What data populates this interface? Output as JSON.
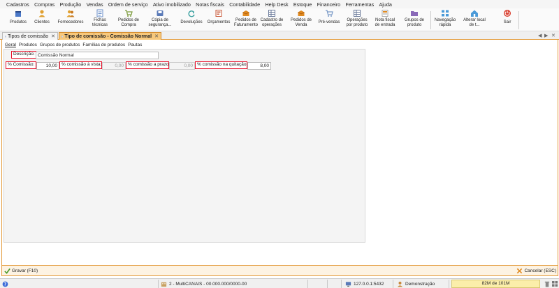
{
  "menu": [
    "Cadastros",
    "Compras",
    "Produção",
    "Vendas",
    "Ordem de serviço",
    "Ativo imobilizado",
    "Notas fiscais",
    "Contabilidade",
    "Help Desk",
    "Estoque",
    "Financeiro",
    "Ferramentas",
    "Ajuda"
  ],
  "toolbar": [
    {
      "l1": "Produtos",
      "l2": "",
      "icon": "box-icon",
      "color": "#4a78c8"
    },
    {
      "l1": "Clientes",
      "l2": "",
      "icon": "person-icon",
      "color": "#e0a030"
    },
    {
      "l1": "Fornecedores",
      "l2": "",
      "icon": "people-icon",
      "color": "#e0a030"
    },
    {
      "l1": "Fichas",
      "l2": "técnicas",
      "icon": "sheet-icon",
      "color": "#6a8fc8"
    },
    {
      "l1": "Pedidos de",
      "l2": "Compra",
      "icon": "cart-icon",
      "color": "#7a9a3a"
    },
    {
      "l1": "Cópia de",
      "l2": "segurança...",
      "icon": "backup-icon",
      "color": "#5a7ab8"
    },
    {
      "l1": "Devoluções",
      "l2": "",
      "icon": "return-icon",
      "color": "#3aa0a0"
    },
    {
      "l1": "Orçamentos",
      "l2": "",
      "icon": "quote-icon",
      "color": "#c85a3a"
    },
    {
      "l1": "Pedidos de",
      "l2": "Faturamento",
      "icon": "box-open-icon",
      "color": "#e08a20"
    },
    {
      "l1": "Cadastro de",
      "l2": "operações",
      "icon": "grid-icon",
      "color": "#6a7a9a"
    },
    {
      "l1": "Pedidos de",
      "l2": "Venda",
      "icon": "box-open-icon",
      "color": "#e08a20"
    },
    {
      "l1": "Pré-vendas",
      "l2": "",
      "icon": "cart-icon",
      "color": "#7a9ac8"
    },
    {
      "l1": "Operações",
      "l2": "por produto",
      "icon": "grid-icon",
      "color": "#6a7a9a"
    },
    {
      "l1": "Nota fiscal",
      "l2": "de entrada",
      "icon": "invoice-icon",
      "color": "#e08a20"
    },
    {
      "l1": "Grupos de",
      "l2": "produto",
      "icon": "folder-icon",
      "color": "#8a6ab8"
    },
    {
      "l1": "Navegação",
      "l2": "rápida",
      "icon": "nav-icon",
      "color": "#4a9ad8"
    },
    {
      "l1": "Alterar local",
      "l2": "de t...",
      "icon": "home-icon",
      "color": "#4a9ad8"
    },
    {
      "l1": "Sair",
      "l2": "",
      "icon": "power-icon",
      "color": "#d83a2a"
    }
  ],
  "tabs": {
    "tab1": "Tipos de comissão",
    "tab2": "Tipo de comissão - Comissão Normal",
    "close": "✕"
  },
  "subtabs": [
    "Geral",
    "Produtos",
    "Grupos de produtos",
    "Famílias de produtos",
    "Pautas"
  ],
  "form": {
    "descricao_label": "Descrição:",
    "descricao_value": "Comissão Normal",
    "comissao_label": "% Comissão:",
    "comissao_value": "10,00",
    "vista_label": "% comissão à vista:",
    "vista_value": "0,00",
    "prazo_label": "% comissão a prazo:",
    "prazo_value": "0,00",
    "quitacao_label": "% comissão na quitação:",
    "quitacao_value": "8,00"
  },
  "actions": {
    "gravar": "Gravar (F10)",
    "cancelar": "Cancelar (ESC)"
  },
  "status": {
    "company": "2 - MultiCANAIS - 00.000.000/0000-00",
    "server": "127.0.0.1:5432",
    "user": "Demonstração",
    "memory": "82M de 101M"
  },
  "colors": {
    "highlight": "#e8102a",
    "accent": "#e39a3a",
    "active_tab": "#f7c87c"
  }
}
